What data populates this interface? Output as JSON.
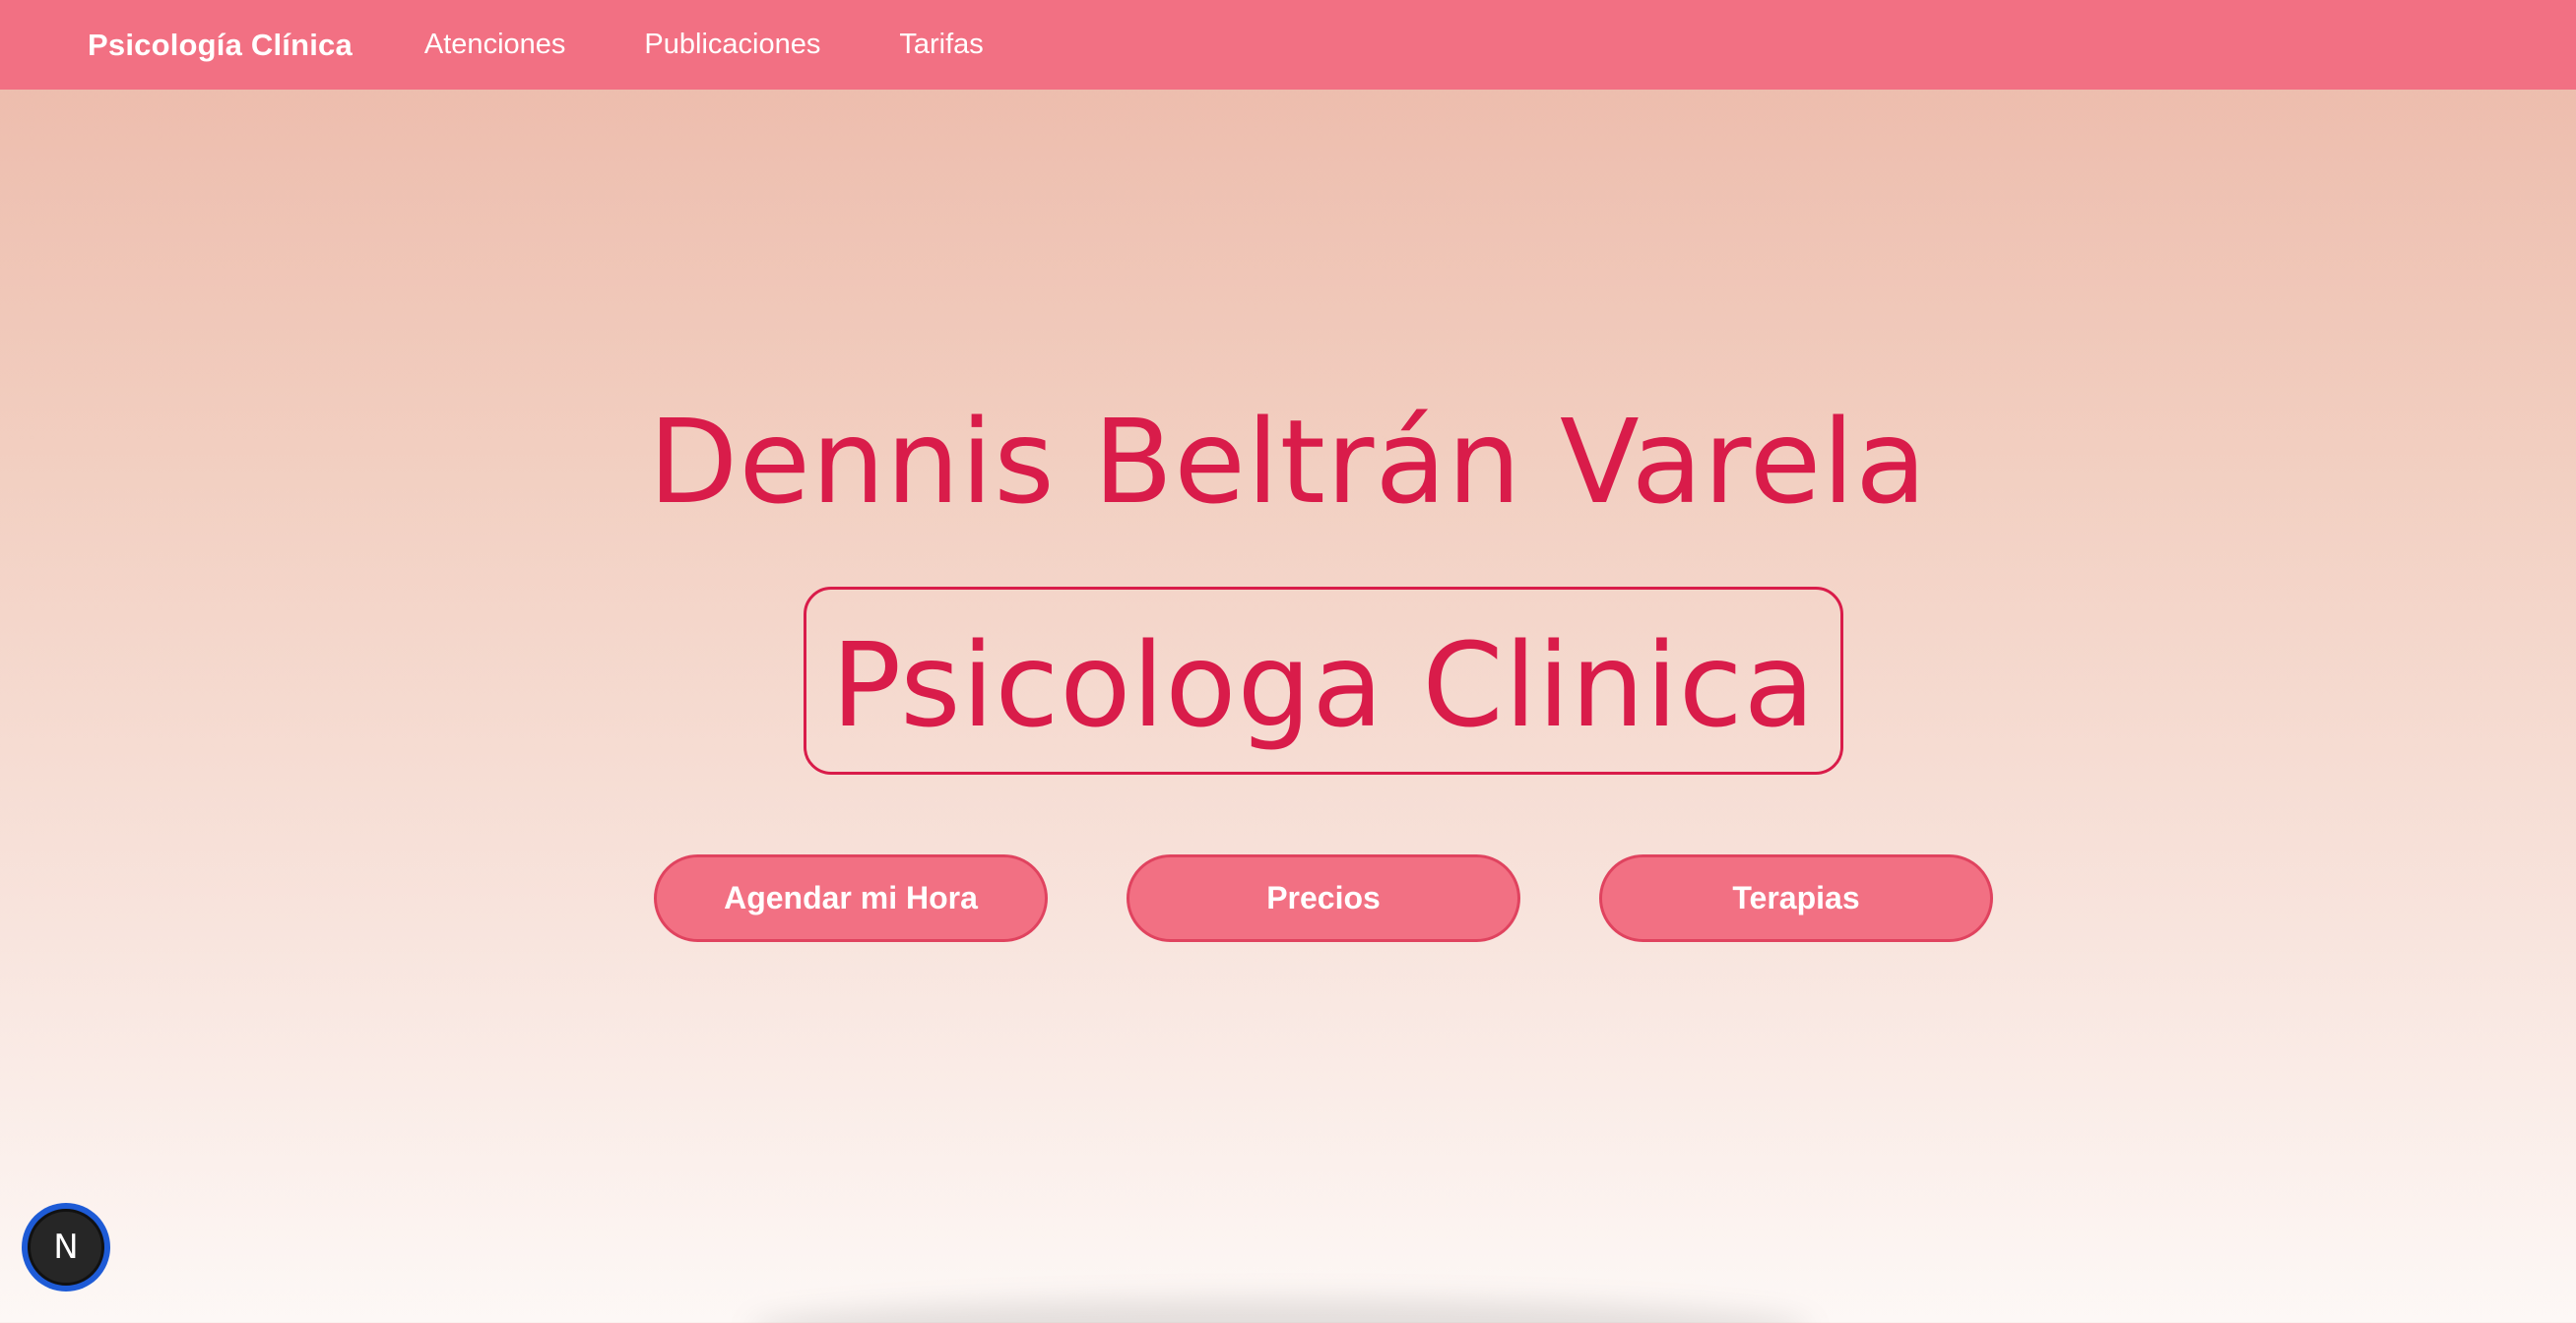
{
  "navbar": {
    "brand": "Psicología Clínica",
    "links": [
      {
        "label": "Atenciones"
      },
      {
        "label": "Publicaciones"
      },
      {
        "label": "Tarifas"
      }
    ],
    "color": "#f27083"
  },
  "hero": {
    "name": "Dennis Beltrán Varela",
    "title": "Psicologa Clinica",
    "accent_color": "#d91c4a"
  },
  "actions": [
    {
      "label": "Agendar mi Hora"
    },
    {
      "label": "Precios"
    },
    {
      "label": "Terapias"
    }
  ],
  "dev_badge": {
    "label": "N",
    "icon": "nextjs-logo-icon"
  }
}
